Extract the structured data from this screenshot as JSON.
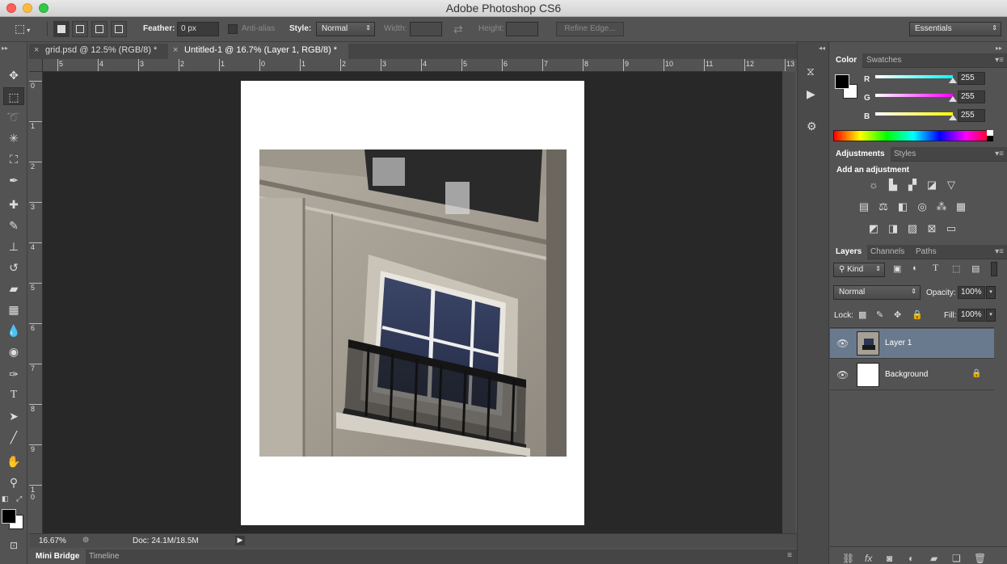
{
  "app": {
    "title": "Adobe Photoshop CS6"
  },
  "options_bar": {
    "feather_label": "Feather:",
    "feather_value": "0 px",
    "anti_alias_label": "Anti-alias",
    "style_label": "Style:",
    "style_value": "Normal",
    "width_label": "Width:",
    "height_label": "Height:",
    "refine_edge_label": "Refine Edge...",
    "workspace_value": "Essentials"
  },
  "doc_tabs": [
    {
      "label": "grid.psd @ 12.5% (RGB/8) *",
      "active": false
    },
    {
      "label": "Untitled-1 @ 16.7% (Layer 1, RGB/8) *",
      "active": true
    }
  ],
  "rulers": {
    "horizontal": [
      "5",
      "4",
      "3",
      "2",
      "1",
      "0",
      "1",
      "2",
      "3",
      "4",
      "5",
      "6",
      "7",
      "8",
      "9",
      "10",
      "11",
      "12",
      "13"
    ],
    "vertical": [
      "0",
      "1",
      "2",
      "3",
      "4",
      "5",
      "6",
      "7",
      "8",
      "9",
      "1 0"
    ]
  },
  "status_bar": {
    "zoom": "16.67%",
    "doc_info": "Doc: 24.1M/18.5M"
  },
  "bottom_tabs": [
    "Mini Bridge",
    "Timeline"
  ],
  "color_panel": {
    "tabs": [
      "Color",
      "Swatches"
    ],
    "channels": [
      {
        "label": "R",
        "value": "255",
        "color": "#00ffff"
      },
      {
        "label": "G",
        "value": "255",
        "color": "#ff00ff"
      },
      {
        "label": "B",
        "value": "255",
        "color": "#ffff00"
      }
    ],
    "foreground": "#000000",
    "background": "#ffffff"
  },
  "adjustments_panel": {
    "tabs": [
      "Adjustments",
      "Styles"
    ],
    "heading": "Add an adjustment",
    "icons": [
      "brightness-icon",
      "levels-icon",
      "curves-icon",
      "exposure-icon",
      "vibrance-icon",
      "hue-saturation-icon",
      "color-balance-icon",
      "black-white-icon",
      "photo-filter-icon",
      "channel-mixer-icon",
      "color-lookup-icon",
      "invert-icon",
      "posterize-icon",
      "threshold-icon",
      "selective-color-icon",
      "gradient-map-icon"
    ]
  },
  "layers_panel": {
    "tabs": [
      "Layers",
      "Channels",
      "Paths"
    ],
    "kind_label": "Kind",
    "blend_mode": "Normal",
    "opacity_label": "Opacity:",
    "opacity_value": "100%",
    "lock_label": "Lock:",
    "fill_label": "Fill:",
    "fill_value": "100%",
    "layers": [
      {
        "name": "Layer 1",
        "selected": true,
        "locked": false
      },
      {
        "name": "Background",
        "selected": false,
        "locked": true
      }
    ]
  }
}
